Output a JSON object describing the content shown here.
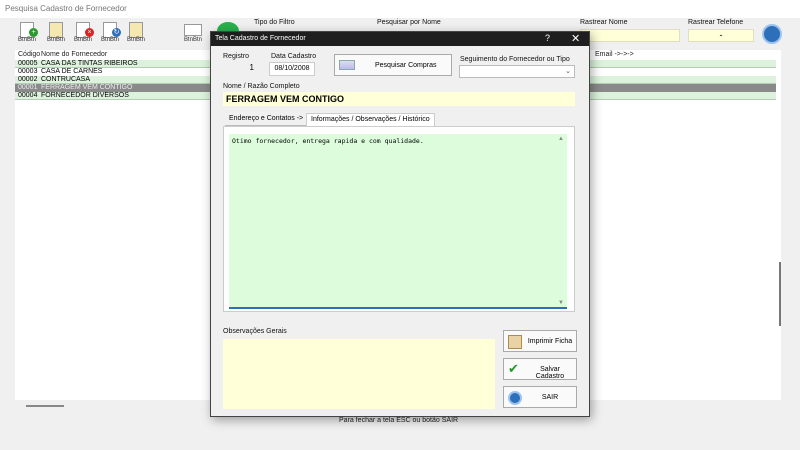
{
  "window": {
    "title": "Pesquisa Cadastro de Fornecedor"
  },
  "toolbar": {
    "button_label": "BtnBtn"
  },
  "filters": {
    "tipo_filtro_label": "Tipo do Filtro",
    "pesquisar_nome_label": "Pesquisar por Nome",
    "rastrear_nome_label": "Rastrear Nome",
    "rastrear_telefone_label": "Rastrear Telefone",
    "rastrear_telefone_value": "-"
  },
  "table": {
    "columns": [
      "Código",
      "Nome do Fornecedor",
      "Email ->->->"
    ],
    "rows": [
      {
        "code": "00005",
        "name": "CASA DAS TINTAS RIBEIROS"
      },
      {
        "code": "00003",
        "name": "CASA DE CARNES"
      },
      {
        "code": "00002",
        "name": "CONTRUCASA"
      },
      {
        "code": "00001",
        "name": "FERRAGEM VEM CONTIGO"
      },
      {
        "code": "00004",
        "name": "FORNECEDOR DIVERSOS"
      }
    ]
  },
  "footer": {
    "text": "Para fechar a tela ESC ou botão SAIR"
  },
  "dialog": {
    "title": "Tela Cadastro de Fornecedor",
    "help": "?",
    "close": "✕",
    "registro_label": "Registro",
    "registro_value": "1",
    "data_label": "Data Cadastro",
    "data_value": "08/10/2008",
    "pesquisar_compras": "Pesquisar Compras",
    "segmento_label": "Seguimento do Fornecedor ou Tipo",
    "segmento_value": "",
    "nome_label": "Nome / Razão Completo",
    "nome_value": "FERRAGEM VEM CONTIGO",
    "tabs": [
      {
        "label": "Endereço e Contatos ->"
      },
      {
        "label": "Informações / Observações / Histórico"
      }
    ],
    "observacoes_text": "Otimo fornecedor, entrega rapida e com qualidade.",
    "obs_gerais_label": "Observações Gerais",
    "obs_gerais_value": "",
    "imprimir": "Imprimir Ficha",
    "salvar": "Salvar Cadastro",
    "sair": "SAIR"
  },
  "colors": {
    "row_green": "#dcf2dc",
    "row_selected": "#8a8a8a",
    "input_yellow": "#ffffd8",
    "textarea_green": "#dcfcdc",
    "dialog_titlebar": "#1e1e1e"
  }
}
